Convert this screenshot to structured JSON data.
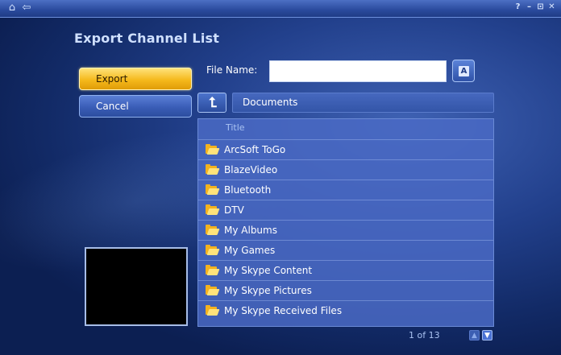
{
  "window": {
    "icons": [
      "home-icon",
      "back-arrow-icon"
    ],
    "controls": [
      {
        "label": "?",
        "icon": "help-icon"
      },
      {
        "label": "–",
        "icon": "minimize-icon"
      },
      {
        "label": "⊡",
        "icon": "restore-icon"
      },
      {
        "label": "✕",
        "icon": "close-icon"
      }
    ]
  },
  "page": {
    "title": "Export Channel List"
  },
  "actions": {
    "export_label": "Export",
    "cancel_label": "Cancel"
  },
  "file_name": {
    "label": "File Name:",
    "value": "",
    "keyboard_glyph": "A"
  },
  "navigation": {
    "up_glyph": "⮤",
    "current_folder": "Documents"
  },
  "list": {
    "column_header": "Title",
    "items": [
      "ArcSoft ToGo",
      "BlazeVideo",
      "Bluetooth",
      "DTV",
      "My Albums",
      "My Games",
      "My Skype Content",
      "My Skype Pictures",
      "My Skype Received Files"
    ]
  },
  "pager": {
    "text": "1 of 13",
    "up_glyph": "▲",
    "down_glyph": "▼"
  },
  "colors": {
    "background": "#22408c",
    "accent_gold": "#f5b91c",
    "list_bg": "#4a6ac4",
    "folder": "#f3b21f"
  }
}
